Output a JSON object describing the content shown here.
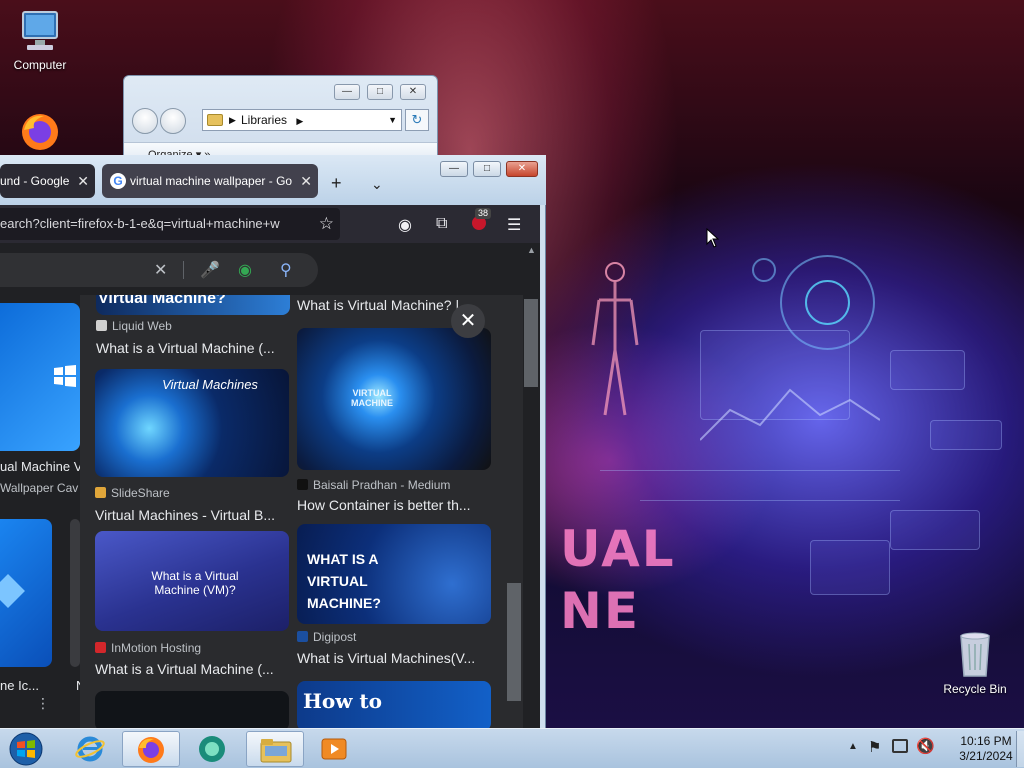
{
  "desktop": {
    "icons": [
      {
        "label": "Computer"
      },
      {
        "label": "Recycle Bin"
      }
    ],
    "wallpaper_text": [
      "UAL",
      "NE"
    ]
  },
  "explorer": {
    "address": "Libraries",
    "toolbar_label": "Organize ▾      »"
  },
  "firefox": {
    "tabs": [
      {
        "title": "und - Google"
      },
      {
        "title": "virtual machine wallpaper - Go"
      }
    ],
    "url": "earch?client=firefox-b-1-e&q=virtual+machine+w",
    "badge_count": "38"
  },
  "left_grid": {
    "texts": [
      "ual Machine V",
      "Wallpaper Cav",
      "ne Ic...",
      "N"
    ]
  },
  "preview": {
    "results": [
      {
        "top_caption": "Virtual Machine?",
        "source": "Liquid Web",
        "title": "What is a Virtual Machine (...",
        "favicon_color": "#d0d0d0"
      },
      {
        "top_caption": "",
        "source": "",
        "title": "What is Virtual Machine? |",
        "favicon_color": "#888888"
      },
      {
        "caption": "Virtual Machines",
        "source": "SlideShare",
        "title": "Virtual Machines - Virtual B...",
        "favicon_color": "#e0a63a"
      },
      {
        "caption": "VIRTUAL MACHINE",
        "source": "Baisali Pradhan - Medium",
        "title": "How Container is better th...",
        "favicon_color": "#111111"
      },
      {
        "caption": "What is a Virtual Machine (VM)?",
        "source": "InMotion Hosting",
        "title": "What is a Virtual Machine (...",
        "favicon_color": "#d3272b"
      },
      {
        "caption": "WHAT IS A VIRTUAL MACHINE?",
        "source": "Digipost",
        "title": "What is Virtual Machines(V...",
        "favicon_color": "#1b4fa0"
      },
      {
        "caption": "How to",
        "source": "",
        "title": "",
        "favicon_color": "#000000"
      }
    ],
    "close_symbol": "✕"
  },
  "taskbar": {
    "time": "10:16 PM",
    "date": "3/21/2024"
  },
  "colors": {
    "firefox_dark": "#2b2a33",
    "google_dark": "#202124",
    "taskbar": "#b6cde4"
  }
}
